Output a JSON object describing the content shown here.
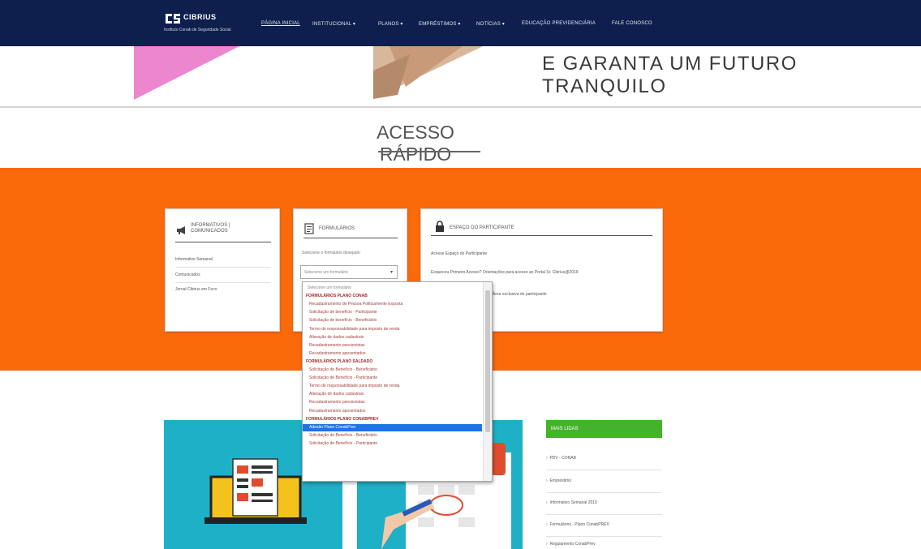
{
  "brand": {
    "name": "CIBRIUS",
    "subtitle": "Instituto Conab de Seguridade Social"
  },
  "nav": {
    "items": [
      {
        "label": "PÁGINA INICIAL",
        "active": true
      },
      {
        "label": "INSTITUCIONAL ▾",
        "active": false
      },
      {
        "label": "PLANOS ▾",
        "active": false
      },
      {
        "label": "EMPRÉSTIMOS ▾",
        "active": false
      },
      {
        "label": "NOTÍCIAS ▾",
        "active": false
      },
      {
        "label": "EDUCAÇÃO PREVIDENCIÁRIA",
        "active": false
      },
      {
        "label": "FALE CONOSCO",
        "active": false
      }
    ]
  },
  "hero": {
    "line1": "E GARANTA UM FUTURO",
    "line2": "TRANQUILO"
  },
  "quick_access": {
    "title": "ACESSO RÁPIDO"
  },
  "cards": {
    "informativos": {
      "title_line1": "INFORMATIVOS |",
      "title_line2": "COMUNICADOS",
      "links": [
        "Informativo Semanal",
        "Comunicados",
        "Jornal Cibrius em Foco"
      ]
    },
    "formularios": {
      "title": "FORMULÁRIOS",
      "hint": "Selecione o formulário desejado:",
      "select_value": "Selecione um formulário",
      "options": [
        {
          "label": "Selecione um formulário",
          "kind": "placeholder"
        },
        {
          "label": "FORMULÁRIOS PLANO CONAB",
          "kind": "head"
        },
        {
          "label": "Recadastramento de Pessoa Politicamente Exposta",
          "kind": "item"
        },
        {
          "label": "Solicitação de benefício - Participante",
          "kind": "item"
        },
        {
          "label": "Solicitação de benefício - Beneficiário",
          "kind": "item"
        },
        {
          "label": "Termo de responsabilidade para imposto de renda",
          "kind": "item"
        },
        {
          "label": "Alteração de dados cadastrais",
          "kind": "item"
        },
        {
          "label": "Recadastramento pensionistas",
          "kind": "item"
        },
        {
          "label": "Recadastramento aposentados",
          "kind": "item"
        },
        {
          "label": "FORMULÁRIOS PLANO SALDADO",
          "kind": "head"
        },
        {
          "label": "Solicitação de Benefício - Beneficiário",
          "kind": "item"
        },
        {
          "label": "Solicitação de Benefício - Participante",
          "kind": "item"
        },
        {
          "label": "Termo de responsabilidade para imposto de renda",
          "kind": "item"
        },
        {
          "label": "Alteração de dados cadastrais",
          "kind": "item"
        },
        {
          "label": "Recadastramento pensionistas",
          "kind": "item"
        },
        {
          "label": "Recadastramento aposentados",
          "kind": "item"
        },
        {
          "label": "FORMULÁRIOS PLANO CONABPREV",
          "kind": "head"
        },
        {
          "label": "Adesão Plano ConabPrev",
          "kind": "item",
          "selected": true
        },
        {
          "label": "Solicitação de Benefício - Beneficiário",
          "kind": "item"
        },
        {
          "label": "Solicitação de Benefício - Participante",
          "kind": "item"
        }
      ]
    },
    "espaco": {
      "title": "ESPAÇO DO PARTICIPANTE",
      "link1": "Acesse Espaço do Participante",
      "link2": "Esqueceu Primeiro Acesso? Orientações para acesso ao Portal Sr. Cibrius@2019",
      "link3": "Área exclusiva do participante"
    }
  },
  "mais_lidas": {
    "title": "MAIS LIDAS",
    "items": [
      "PDV - CONAB",
      "Empréstimo",
      "Informativo Semanal 2019",
      "Formulários - Plano ConabPREV",
      "Regulamento ConabPrev"
    ]
  },
  "colors": {
    "nav": "#0e1f4d",
    "orange": "#fa6a0a",
    "teal": "#1eb0c6",
    "green": "#43b32a",
    "selected": "#1e73e8"
  }
}
